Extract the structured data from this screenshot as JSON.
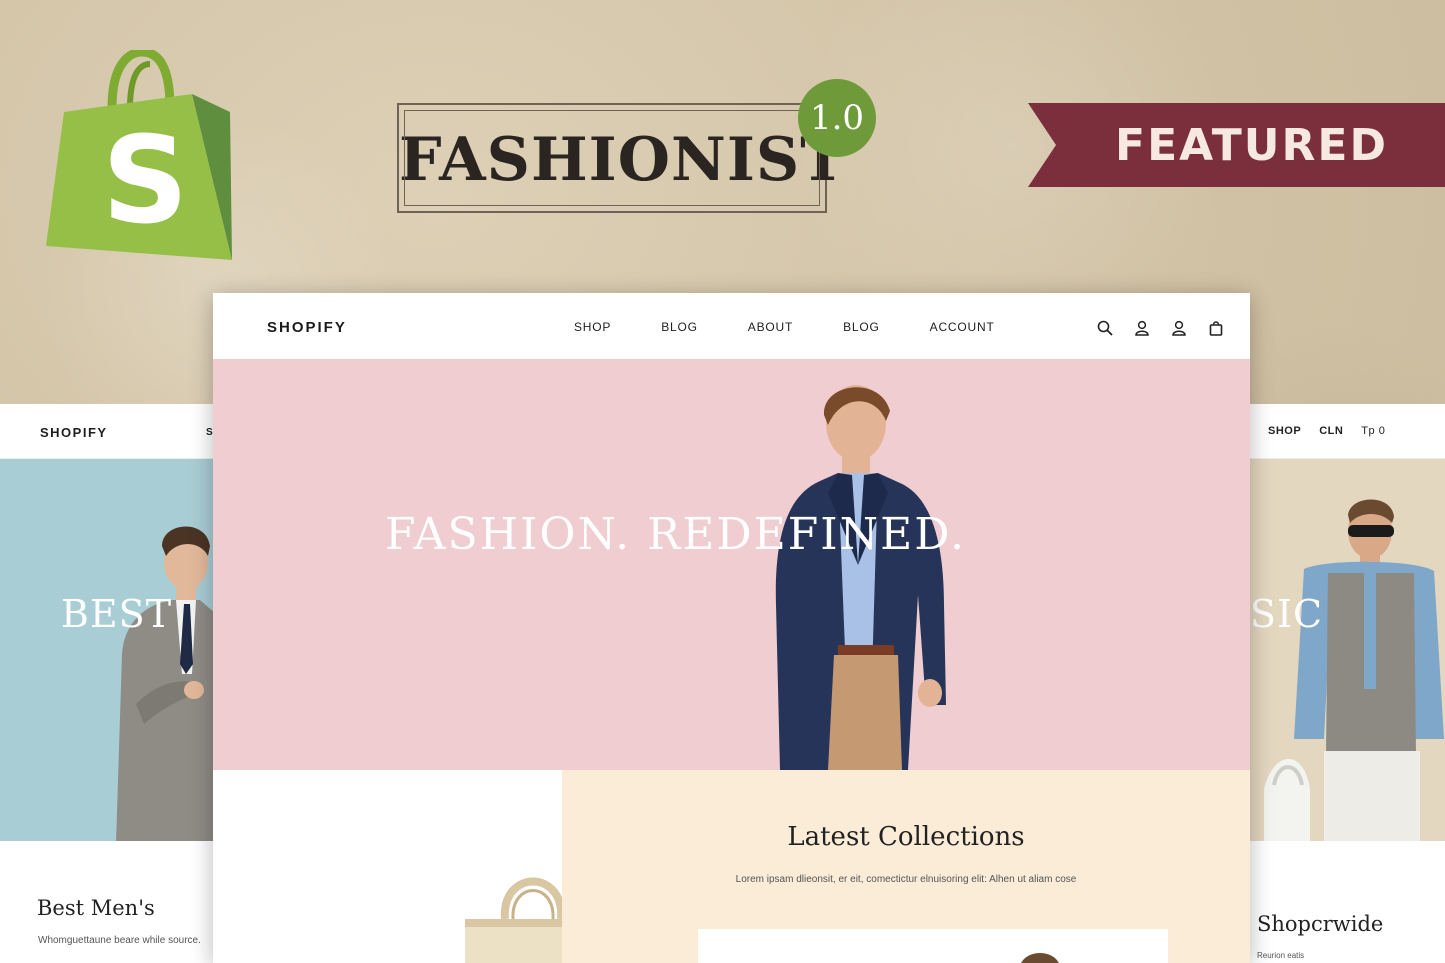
{
  "promo": {
    "product_name": "FASHIONIST",
    "version": "1.0",
    "ribbon_label": "FEATURED",
    "platform_logo_letter": "S"
  },
  "main_mockup": {
    "nav": {
      "logo": "SHOPIFY",
      "links": [
        "SHOP",
        "BLOG",
        "ABOUT",
        "BLOG",
        "ACCOUNT"
      ],
      "icons": [
        "search-icon",
        "user-icon",
        "account-icon",
        "cart-icon"
      ]
    },
    "hero": {
      "headline": "FASHION. REDEFINED."
    },
    "collections": {
      "title": "Latest Collections",
      "subtitle": "Lorem ipsam dlieonsit, er eit, comectictur elnuisoring elit: Alhen ut aliam cose"
    }
  },
  "left_mockup": {
    "nav_logo": "SHOPIFY",
    "nav_fragment": "S",
    "hero_text": "BEST",
    "product_title": "Best Men's",
    "product_sub": "Whomguettaune beare while source."
  },
  "right_mockup": {
    "nav_items": [
      "SHOP",
      "CLN",
      "Tp 0"
    ],
    "hero_text": "SIC",
    "product_title": "Shopcrwide",
    "product_sub": "Reurion eatis"
  },
  "colors": {
    "background": "#d2c3a6",
    "shopify_green": "#95bf47",
    "badge_green": "#6e9a39",
    "ribbon": "#7b2f3c",
    "hero_pink": "#efcdd1",
    "left_hero_blue": "#a9cdd4",
    "collections_cream": "#faecd7"
  }
}
